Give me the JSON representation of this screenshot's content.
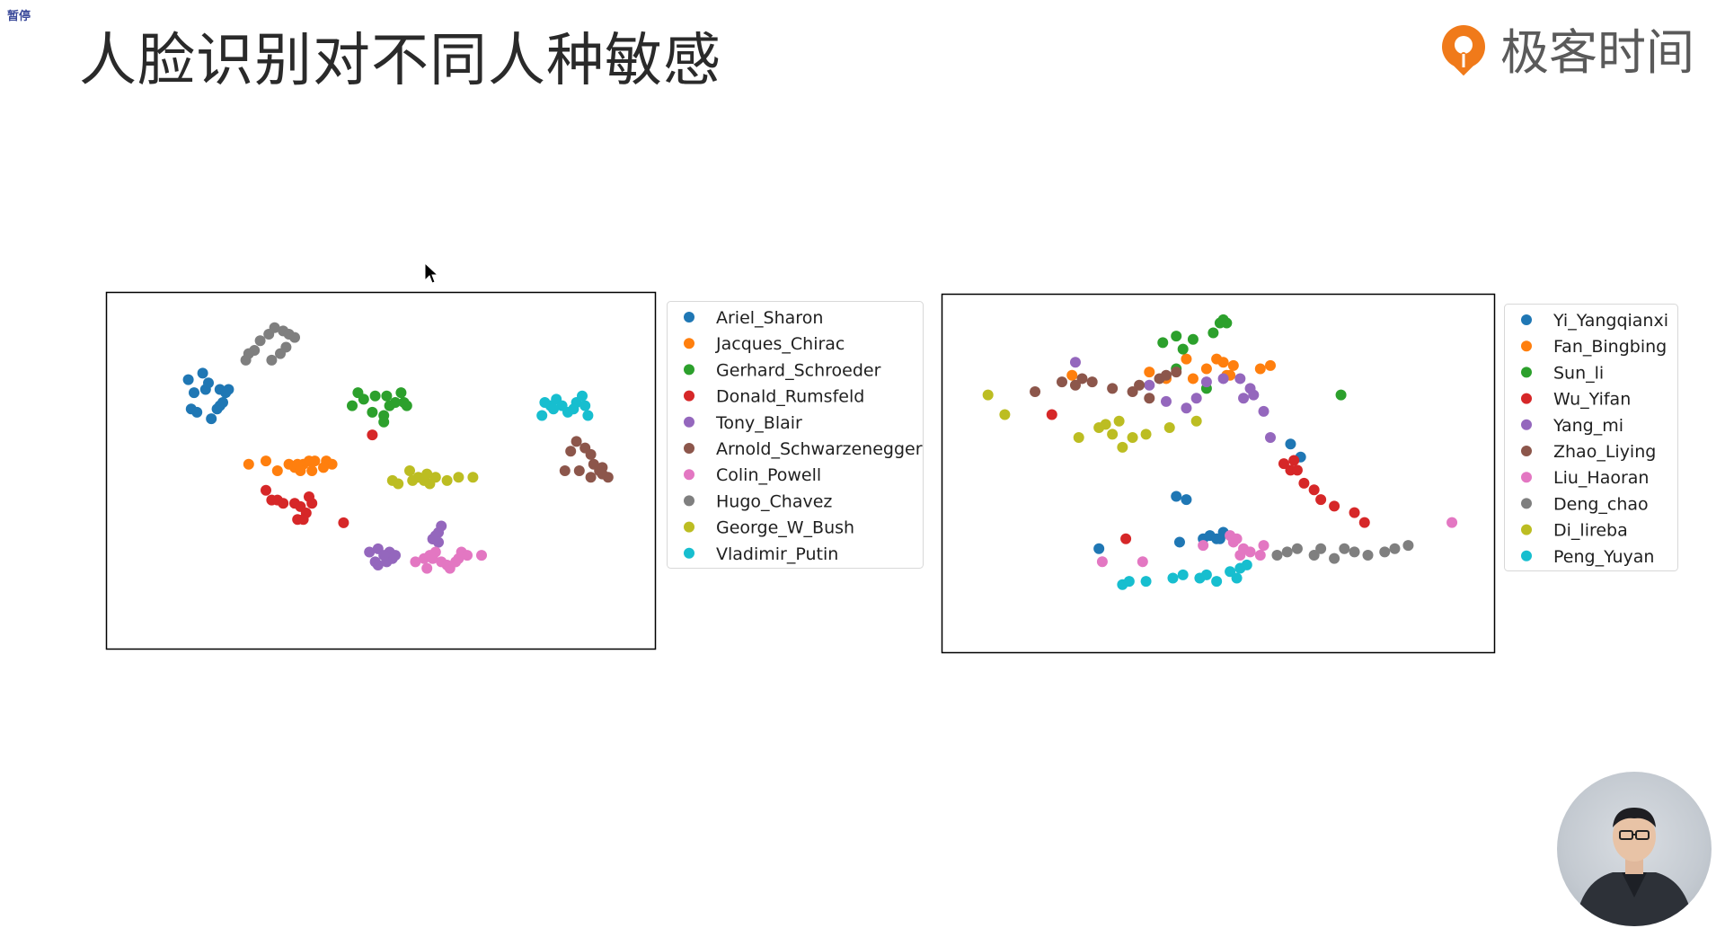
{
  "overlay": {
    "pause_tag": "暂停"
  },
  "slide": {
    "title": "人脸识别对不同人种敏感",
    "brand": {
      "name": "极客时间",
      "logo_icon": "geektime-logo-icon",
      "accent": "#f07a1a"
    }
  },
  "chart_data": [
    {
      "type": "scatter",
      "title": "",
      "xlabel": "",
      "ylabel": "",
      "grid": false,
      "axis_ticks": false,
      "legend_placement": "outside-right",
      "series": [
        {
          "name": "Ariel_Sharon",
          "color": "#1f77b4",
          "points": [
            [
              24,
              69
            ],
            [
              26,
              68
            ],
            [
              31,
              66
            ],
            [
              33,
              69
            ],
            [
              25,
              74
            ],
            [
              23,
              78
            ],
            [
              29,
              75
            ],
            [
              34,
              70
            ],
            [
              35,
              71
            ],
            [
              34,
              75
            ],
            [
              30,
              77
            ],
            [
              37,
              75
            ],
            [
              36,
              74
            ],
            [
              28,
              80
            ]
          ]
        },
        {
          "name": "Jacques_Chirac",
          "color": "#ff7f0e",
          "points": [
            [
              44,
              52
            ],
            [
              50,
              53
            ],
            [
              54,
              50
            ],
            [
              58,
              52
            ],
            [
              60,
              51
            ],
            [
              63,
              52
            ],
            [
              66,
              50
            ],
            [
              65,
              53
            ],
            [
              67,
              53
            ],
            [
              71,
              53
            ],
            [
              73,
              52
            ],
            [
              70,
              51
            ],
            [
              61,
              52
            ],
            [
              62,
              50
            ]
          ]
        },
        {
          "name": "Gerhard_Schroeder",
          "color": "#2ca02c",
          "points": [
            [
              80,
              70
            ],
            [
              84,
              72
            ],
            [
              88,
              73
            ],
            [
              92,
              73
            ],
            [
              95,
              71
            ],
            [
              98,
              71
            ],
            [
              97,
              74
            ],
            [
              99,
              70
            ],
            [
              87,
              68
            ],
            [
              91,
              67
            ],
            [
              93,
              70
            ],
            [
              91,
              65
            ],
            [
              82,
              74
            ]
          ]
        },
        {
          "name": "Donald_Rumsfeld",
          "color": "#d62728",
          "points": [
            [
              87,
              61
            ],
            [
              50,
              44
            ],
            [
              52,
              41
            ],
            [
              54,
              41
            ],
            [
              56,
              40
            ],
            [
              60,
              40
            ],
            [
              62,
              39
            ],
            [
              64,
              37
            ],
            [
              65,
              42
            ],
            [
              66,
              40
            ],
            [
              61,
              35
            ],
            [
              63,
              35
            ],
            [
              77,
              34
            ]
          ]
        },
        {
          "name": "Tony_Blair",
          "color": "#9467bd",
          "points": [
            [
              86,
              25
            ],
            [
              89,
              26
            ],
            [
              93,
              25
            ],
            [
              95,
              24
            ],
            [
              94,
              23
            ],
            [
              92,
              22
            ],
            [
              89,
              21
            ],
            [
              88,
              22
            ],
            [
              91,
              24
            ],
            [
              110,
              31
            ],
            [
              111,
              33
            ],
            [
              109,
              30
            ],
            [
              108,
              29
            ],
            [
              110,
              28
            ]
          ]
        },
        {
          "name": "Arnold_Schwarzenegger",
          "color": "#8c564b",
          "points": [
            [
              156,
              56
            ],
            [
              158,
              59
            ],
            [
              161,
              57
            ],
            [
              163,
              55
            ],
            [
              164,
              52
            ],
            [
              166,
              50
            ],
            [
              167,
              49
            ],
            [
              167,
              51
            ],
            [
              169,
              48
            ],
            [
              163,
              48
            ],
            [
              159,
              50
            ],
            [
              154,
              50
            ]
          ]
        },
        {
          "name": "Colin_Powell",
          "color": "#e377c2",
          "points": [
            [
              102,
              22
            ],
            [
              105,
              23
            ],
            [
              107,
              24
            ],
            [
              109,
              25
            ],
            [
              111,
              22
            ],
            [
              114,
              20
            ],
            [
              116,
              22
            ],
            [
              117,
              23
            ],
            [
              118,
              25
            ],
            [
              120,
              24
            ],
            [
              125,
              24
            ],
            [
              113,
              21
            ],
            [
              108,
              23
            ],
            [
              106,
              20
            ]
          ]
        },
        {
          "name": "Hugo_Chavez",
          "color": "#7f7f7f",
          "points": [
            [
              43,
              84
            ],
            [
              46,
              87
            ],
            [
              48,
              90
            ],
            [
              51,
              92
            ],
            [
              53,
              94
            ],
            [
              56,
              93
            ],
            [
              58,
              92
            ],
            [
              60,
              91
            ],
            [
              57,
              88
            ],
            [
              55,
              86
            ],
            [
              52,
              84
            ],
            [
              44,
              86
            ]
          ]
        },
        {
          "name": "George_W_Bush",
          "color": "#bcbd22",
          "points": [
            [
              94,
              47
            ],
            [
              96,
              46
            ],
            [
              101,
              47
            ],
            [
              103,
              48
            ],
            [
              105,
              47
            ],
            [
              107,
              46
            ],
            [
              109,
              48
            ],
            [
              113,
              47
            ],
            [
              117,
              48
            ],
            [
              122,
              48
            ],
            [
              100,
              50
            ],
            [
              106,
              49
            ]
          ]
        },
        {
          "name": "Vladimir_Putin",
          "color": "#17becf",
          "points": [
            [
              146,
              67
            ],
            [
              149,
              70
            ],
            [
              151,
              72
            ],
            [
              153,
              70
            ],
            [
              155,
              68
            ],
            [
              158,
              71
            ],
            [
              161,
              70
            ],
            [
              162,
              67
            ],
            [
              160,
              73
            ],
            [
              157,
              69
            ],
            [
              150,
              69
            ],
            [
              147,
              71
            ]
          ]
        }
      ]
    },
    {
      "type": "scatter",
      "title": "",
      "xlabel": "",
      "ylabel": "",
      "grid": false,
      "axis_ticks": false,
      "legend_placement": "outside-right",
      "series": [
        {
          "name": "Yi_Yangqianxi",
          "color": "#1f77b4",
          "points": [
            [
              42,
              27
            ],
            [
              66,
              29
            ],
            [
              73,
              30
            ],
            [
              75,
              31
            ],
            [
              77,
              30
            ],
            [
              78,
              30
            ],
            [
              79,
              32
            ],
            [
              82,
              30
            ],
            [
              99,
              59
            ],
            [
              102,
              55
            ],
            [
              65,
              43
            ],
            [
              68,
              42
            ]
          ]
        },
        {
          "name": "Fan_Bingbing",
          "color": "#ff7f0e",
          "points": [
            [
              34,
              80
            ],
            [
              57,
              81
            ],
            [
              62,
              79
            ],
            [
              70,
              79
            ],
            [
              74,
              82
            ],
            [
              77,
              85
            ],
            [
              79,
              84
            ],
            [
              80,
              80
            ],
            [
              82,
              83
            ],
            [
              81,
              80
            ],
            [
              90,
              82
            ],
            [
              93,
              83
            ],
            [
              68,
              85
            ]
          ]
        },
        {
          "name": "Sun_li",
          "color": "#2ca02c",
          "points": [
            [
              61,
              90
            ],
            [
              65,
              92
            ],
            [
              67,
              88
            ],
            [
              70,
              91
            ],
            [
              76,
              93
            ],
            [
              79,
              97
            ],
            [
              80,
              96
            ],
            [
              78,
              96
            ],
            [
              74,
              76
            ],
            [
              114,
              74
            ],
            [
              65,
              82
            ]
          ]
        },
        {
          "name": "Wu_Yifan",
          "color": "#d62728",
          "points": [
            [
              28,
              68
            ],
            [
              50,
              30
            ],
            [
              97,
              53
            ],
            [
              99,
              51
            ],
            [
              100,
              54
            ],
            [
              101,
              51
            ],
            [
              103,
              47
            ],
            [
              106,
              45
            ],
            [
              108,
              42
            ],
            [
              112,
              40
            ],
            [
              118,
              38
            ],
            [
              121,
              35
            ]
          ]
        },
        {
          "name": "Yang_mi",
          "color": "#9467bd",
          "points": [
            [
              35,
              84
            ],
            [
              57,
              77
            ],
            [
              62,
              72
            ],
            [
              68,
              70
            ],
            [
              71,
              73
            ],
            [
              74,
              78
            ],
            [
              79,
              79
            ],
            [
              84,
              79
            ],
            [
              87,
              76
            ],
            [
              88,
              74
            ],
            [
              91,
              69
            ],
            [
              93,
              61
            ],
            [
              85,
              73
            ]
          ]
        },
        {
          "name": "Zhao_Liying",
          "color": "#8c564b",
          "points": [
            [
              23,
              75
            ],
            [
              31,
              78
            ],
            [
              35,
              77
            ],
            [
              37,
              79
            ],
            [
              40,
              78
            ],
            [
              46,
              76
            ],
            [
              52,
              75
            ],
            [
              57,
              73
            ],
            [
              60,
              79
            ],
            [
              62,
              80
            ],
            [
              65,
              81
            ],
            [
              54,
              77
            ]
          ]
        },
        {
          "name": "Liu_Haoran",
          "color": "#e377c2",
          "points": [
            [
              43,
              23
            ],
            [
              55,
              23
            ],
            [
              73,
              28
            ],
            [
              81,
              31
            ],
            [
              82,
              29
            ],
            [
              83,
              30
            ],
            [
              84,
              25
            ],
            [
              85,
              27
            ],
            [
              87,
              26
            ],
            [
              90,
              25
            ],
            [
              91,
              28
            ],
            [
              147,
              35
            ]
          ]
        },
        {
          "name": "Deng_chao",
          "color": "#7f7f7f",
          "points": [
            [
              95,
              25
            ],
            [
              98,
              26
            ],
            [
              101,
              27
            ],
            [
              106,
              25
            ],
            [
              108,
              27
            ],
            [
              112,
              24
            ],
            [
              115,
              27
            ],
            [
              118,
              26
            ],
            [
              122,
              25
            ],
            [
              127,
              26
            ],
            [
              130,
              27
            ],
            [
              134,
              28
            ]
          ]
        },
        {
          "name": "Di_lireba",
          "color": "#bcbd22",
          "points": [
            [
              9,
              74
            ],
            [
              14,
              68
            ],
            [
              36,
              61
            ],
            [
              42,
              64
            ],
            [
              44,
              65
            ],
            [
              46,
              62
            ],
            [
              49,
              58
            ],
            [
              52,
              61
            ],
            [
              56,
              62
            ],
            [
              63,
              64
            ],
            [
              71,
              66
            ],
            [
              48,
              66
            ]
          ]
        },
        {
          "name": "Peng_Yuyan",
          "color": "#17becf",
          "points": [
            [
              49,
              16
            ],
            [
              51,
              17
            ],
            [
              56,
              17
            ],
            [
              64,
              18
            ],
            [
              67,
              19
            ],
            [
              72,
              18
            ],
            [
              74,
              19
            ],
            [
              77,
              17
            ],
            [
              81,
              20
            ],
            [
              84,
              21
            ],
            [
              86,
              22
            ],
            [
              83,
              18
            ]
          ]
        }
      ]
    }
  ]
}
